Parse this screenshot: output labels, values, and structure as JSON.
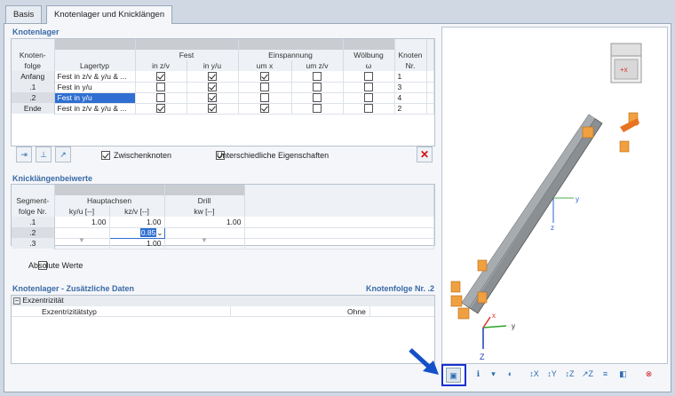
{
  "tabs": [
    {
      "label": "Basis"
    },
    {
      "label": "Knotenlager und Knicklängen"
    }
  ],
  "knotenlager": {
    "title": "Knotenlager",
    "group_headers": {
      "fest": "Fest",
      "einspannung": "Einspannung",
      "woelbung": "Wölbung",
      "knoten": "Knoten"
    },
    "col_headers": {
      "knotenfolge": "Knoten-",
      "knotenfolge2": "folge",
      "lagertyp": "Lagertyp",
      "in_zv": "in z/v",
      "in_yu": "in y/u",
      "um_x": "um x",
      "um_zv": "um z/v",
      "omega": "ω",
      "nr": "Nr."
    },
    "rows": [
      {
        "folge": "Anfang",
        "lagertyp": "Fest in z/v & y/u & ...",
        "zv": true,
        "yu": true,
        "umx": true,
        "umzv": false,
        "omega": false,
        "nr": "1"
      },
      {
        "folge": ".1",
        "lagertyp": "Fest in y/u",
        "zv": false,
        "yu": true,
        "umx": false,
        "umzv": false,
        "omega": false,
        "nr": "3"
      },
      {
        "folge": ".2",
        "lagertyp": "Fest in y/u",
        "zv": false,
        "yu": true,
        "umx": false,
        "umzv": false,
        "omega": false,
        "nr": "4"
      },
      {
        "folge": "Ende",
        "lagertyp": "Fest in z/v & y/u & ...",
        "zv": true,
        "yu": true,
        "umx": true,
        "umzv": false,
        "omega": false,
        "nr": "2"
      }
    ],
    "zwischenknoten": "Zwischenknoten",
    "unterschiedliche": "Unterschiedliche Eigenschaften"
  },
  "knick": {
    "title": "Knicklängenbeiwerte",
    "hdr": {
      "seg1": "Segment-",
      "seg2": "folge Nr.",
      "haupt": "Hauptachsen",
      "drill": "Drill",
      "kyu": "ky/u [--]",
      "kzv": "kz/v [--]",
      "kw": "kw [--]"
    },
    "rows": [
      {
        "nr": ".1",
        "kyu": "1.00",
        "kzv": "1.00",
        "kw": "1.00"
      },
      {
        "nr": ".2",
        "kyu": "",
        "kzv": "0.85",
        "kw": ""
      },
      {
        "nr": ".3",
        "kyu": "",
        "kzv": "1.00",
        "kw": ""
      }
    ],
    "absolute": "Absolute Werte"
  },
  "zusatz": {
    "title": "Knotenlager - Zusätzliche Daten",
    "right": "Knotenfolge Nr. .2",
    "group": "Exzentrizität",
    "item_label": "Exzentrizitätstyp",
    "item_value": "Ohne"
  },
  "view": {
    "axis_x": "x",
    "axis_y": "y",
    "axis_z": "z",
    "axis_Z": "Z",
    "cube_label": "+x"
  },
  "colors": {
    "accent": "#2f6fd1",
    "highlight_box": "#1a2fd1",
    "arrow": "#1450c8",
    "support": "#f0a040"
  }
}
